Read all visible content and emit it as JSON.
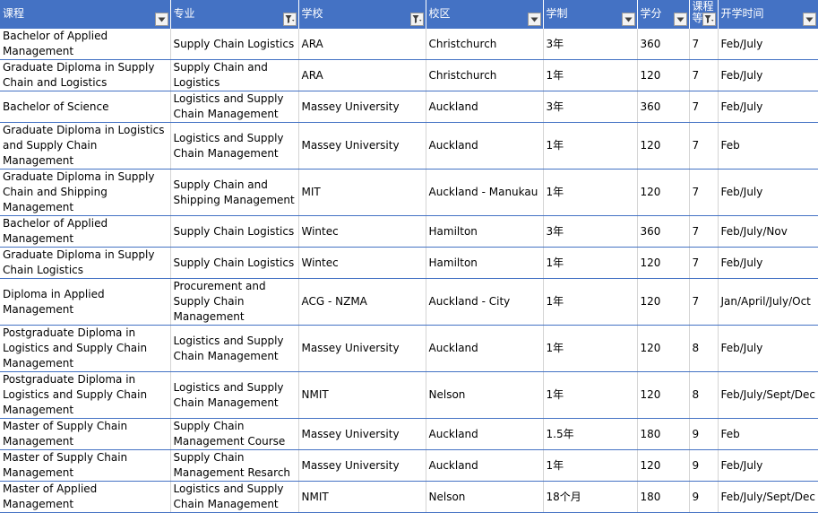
{
  "header": [
    {
      "label": "课程",
      "filter": "dropdown"
    },
    {
      "label": "专业",
      "filter": "filtered"
    },
    {
      "label": "学校",
      "filter": "filtered"
    },
    {
      "label": "校区",
      "filter": "dropdown"
    },
    {
      "label": "学制",
      "filter": "dropdown"
    },
    {
      "label": "学分",
      "filter": "dropdown"
    },
    {
      "label": "课程等",
      "filter": "filtered"
    },
    {
      "label": "开学时间",
      "filter": "dropdown"
    }
  ],
  "rows": [
    [
      "Bachelor of Applied Management",
      "Supply Chain Logistics",
      "ARA",
      "Christchurch",
      "3年",
      "360",
      "7",
      "Feb/July"
    ],
    [
      "Graduate Diploma in Supply Chain and Logistics",
      "Supply Chain and Logistics",
      "ARA",
      "Christchurch",
      "1年",
      "120",
      "7",
      "Feb/July"
    ],
    [
      "Bachelor of Science",
      "Logistics and Supply Chain Management",
      "Massey University",
      "Auckland",
      "3年",
      "360",
      "7",
      "Feb/July"
    ],
    [
      "Graduate Diploma in Logistics and Supply Chain Management",
      "Logistics and Supply Chain Management",
      "Massey University",
      "Auckland",
      "1年",
      "120",
      "7",
      "Feb"
    ],
    [
      "Graduate Diploma in Supply Chain and Shipping Management",
      "Supply Chain and Shipping Management",
      "MIT",
      "Auckland - Manukau",
      "1年",
      "120",
      "7",
      "Feb/July"
    ],
    [
      "Bachelor of Applied Management",
      "Supply Chain Logistics",
      "Wintec",
      "Hamilton",
      "3年",
      "360",
      "7",
      "Feb/July/Nov"
    ],
    [
      "Graduate Diploma in Supply Chain Logistics",
      "Supply Chain Logistics",
      "Wintec",
      "Hamilton",
      "1年",
      "120",
      "7",
      "Feb/July"
    ],
    [
      "Diploma in Applied Management",
      "Procurement and Supply Chain Management",
      "ACG - NZMA",
      "Auckland - City",
      "1年",
      "120",
      "7",
      "Jan/April/July/Oct"
    ],
    [
      "Postgraduate Diploma in Logistics and Supply Chain Management",
      "Logistics and Supply Chain Management",
      "Massey University",
      "Auckland",
      "1年",
      "120",
      "8",
      "Feb/July"
    ],
    [
      "Postgraduate Diploma in Logistics and Supply Chain Management",
      "Logistics and Supply Chain Management",
      "NMIT",
      "Nelson",
      "1年",
      "120",
      "8",
      "Feb/July/Sept/Dec"
    ],
    [
      "Master of Supply Chain Management",
      "Supply Chain Management Course",
      "Massey University",
      "Auckland",
      "1.5年",
      "180",
      "9",
      "Feb"
    ],
    [
      "Master of Supply Chain Management",
      "Supply Chain Management Resarch",
      "Massey University",
      "Auckland",
      "1年",
      "120",
      "9",
      "Feb/July"
    ],
    [
      "Master of Applied Management",
      "Logistics and Supply Chain Management",
      "NMIT",
      "Nelson",
      "18个月",
      "180",
      "9",
      "Feb/July/Sept/Dec"
    ]
  ]
}
